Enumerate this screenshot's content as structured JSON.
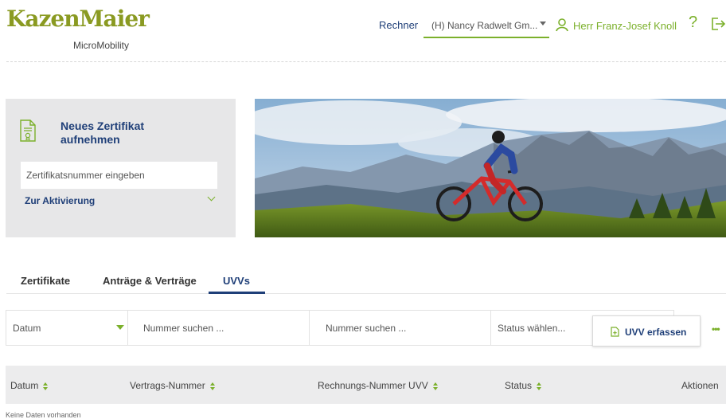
{
  "header": {
    "logo_main": "KazenMaier",
    "logo_sub": "MicroMobility",
    "rechner_label": "Rechner",
    "company_selected": "(H) Nancy Radwelt Gm...",
    "user_name": "Herr Franz-Josef Knoll",
    "help_glyph": "?",
    "icons": [
      "user-icon",
      "help-icon",
      "logout-icon"
    ]
  },
  "certificate_card": {
    "title": "Neues Zertifikat aufnehmen",
    "input_placeholder": "Zertifikatsnummer eingeben",
    "activation_label": "Zur Aktivierung",
    "icon": "certificate-icon"
  },
  "tabs": [
    {
      "label": "Zertifikate",
      "active": false
    },
    {
      "label": "Anträge & Verträge",
      "active": false
    },
    {
      "label": "UVVs",
      "active": true
    }
  ],
  "filters": {
    "date_select": "Datum",
    "number_search_1": "Nummer suchen ...",
    "number_search_2": "Nummer suchen ...",
    "status_select": "Status wählen..."
  },
  "actions": {
    "uvv_button_label": "UVV erfassen",
    "more_glyph": "•••"
  },
  "table": {
    "columns": [
      "Datum",
      "Vertrags-Nummer",
      "Rechnungs-Nummer UVV",
      "Status",
      "Aktionen"
    ],
    "empty_text": "Keine Daten vorhanden"
  },
  "colors": {
    "brand_green": "#7bb02b",
    "navy": "#1f3f78",
    "logo_olive": "#8a9a22",
    "panel_gray": "#e7e7e8"
  }
}
